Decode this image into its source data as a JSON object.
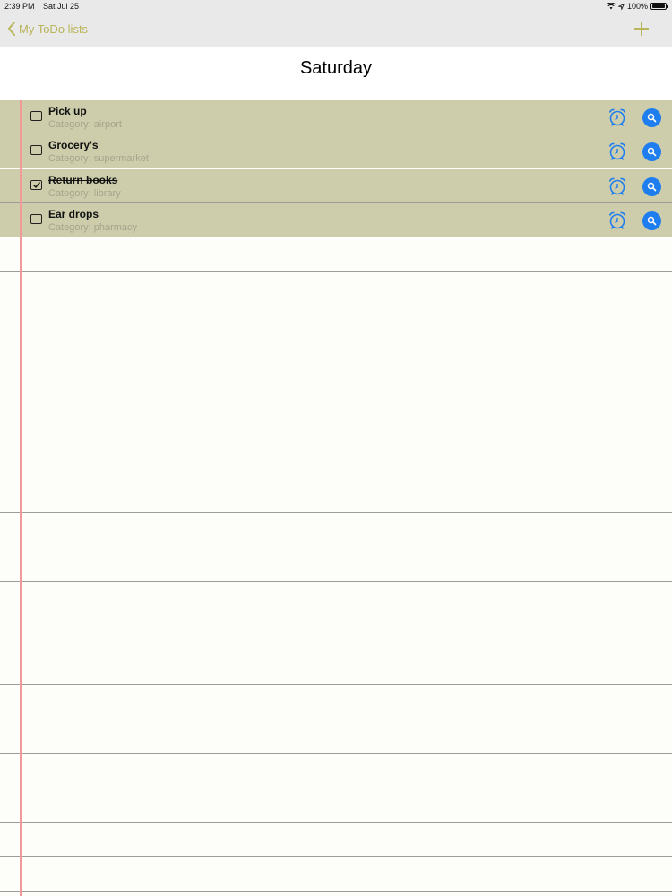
{
  "status_bar": {
    "time": "2:39 PM",
    "date": "Sat Jul 25",
    "battery": "100%",
    "icons": [
      "wifi-icon",
      "location-icon",
      "battery-icon"
    ]
  },
  "nav": {
    "back_label": "My ToDo lists",
    "back_icon": "chevron-left-icon",
    "add_icon": "plus-icon"
  },
  "page": {
    "title": "Saturday"
  },
  "colors": {
    "accent": "#b8b55a",
    "row_background": "#cdcdab",
    "action_blue": "#1e7ef0",
    "margin_line": "#f09a9a"
  },
  "todos": [
    {
      "title": "Pick up",
      "category": "Category:  airport",
      "done": false
    },
    {
      "title": "Grocery's",
      "category": "Category:  supermarket",
      "done": false
    },
    {
      "title": "Return books",
      "category": "Category:  library",
      "done": true
    },
    {
      "title": "Ear drops",
      "category": "Category:  pharmacy",
      "done": false
    }
  ]
}
